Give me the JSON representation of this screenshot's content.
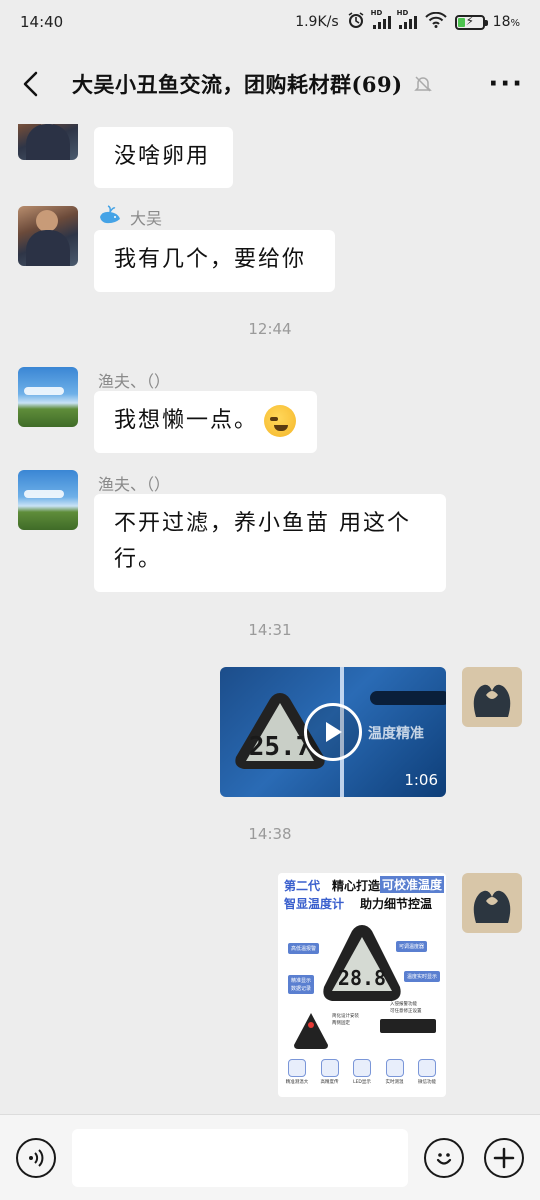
{
  "status_bar": {
    "time": "14:40",
    "net_speed": "1.9K/s",
    "battery_percent": "18",
    "battery_unit": "%",
    "sim1_label": "HD",
    "sim2_label": "HD"
  },
  "header": {
    "title": "大吴小丑鱼交流，团购耗材群(69)"
  },
  "messages": [
    {
      "type": "text",
      "side": "left",
      "sender": "",
      "text": "没啥卵用"
    },
    {
      "type": "text",
      "side": "left",
      "sender": "大吴",
      "text": "我有几个，要给你"
    },
    {
      "type": "time",
      "text": "12:44"
    },
    {
      "type": "text",
      "side": "left",
      "sender": "渔夫、（）",
      "text": "我想懒一点。"
    },
    {
      "type": "text",
      "side": "left",
      "sender": "渔夫、（）",
      "text_line1": "不开过滤，养小鱼苗 用这个",
      "text_line2": "行。"
    },
    {
      "type": "time",
      "text": "14:31"
    },
    {
      "type": "video",
      "side": "right",
      "caption": "温度精准",
      "display": "25.7",
      "duration": "1:06"
    },
    {
      "type": "time",
      "text": "14:38"
    },
    {
      "type": "image",
      "side": "right",
      "headline_1a": "第二代",
      "headline_1b": "精心打造",
      "headline_1c": "可校准温度",
      "headline_2a": "智显温度计",
      "headline_2b": "助力细节控温",
      "display": "28.8",
      "tag_1": "高低温报警",
      "tag_2": "可调温度器",
      "tag_3": "精准显示",
      "tag_4": "数据记录",
      "tag_5": "温度实时显示",
      "note_1": "简化设计安装",
      "note_2": "两侧固定",
      "note_3": "入侵报警功能",
      "note_4": "可任意修正设置"
    }
  ],
  "product_icons": [
    "精准测温大",
    "高精度传",
    "LED显示",
    "实时测温",
    "微信功能"
  ],
  "colors": {
    "background": "#ededed",
    "bubble": "#ffffff",
    "product_blue": "#3a5fcd",
    "video_blue": "#2a6bb5"
  },
  "icons": [
    "back-arrow-icon",
    "mute-bell-icon",
    "more-icon",
    "voice-icon",
    "emoji-icon",
    "plus-icon",
    "play-icon",
    "whale-icon"
  ]
}
